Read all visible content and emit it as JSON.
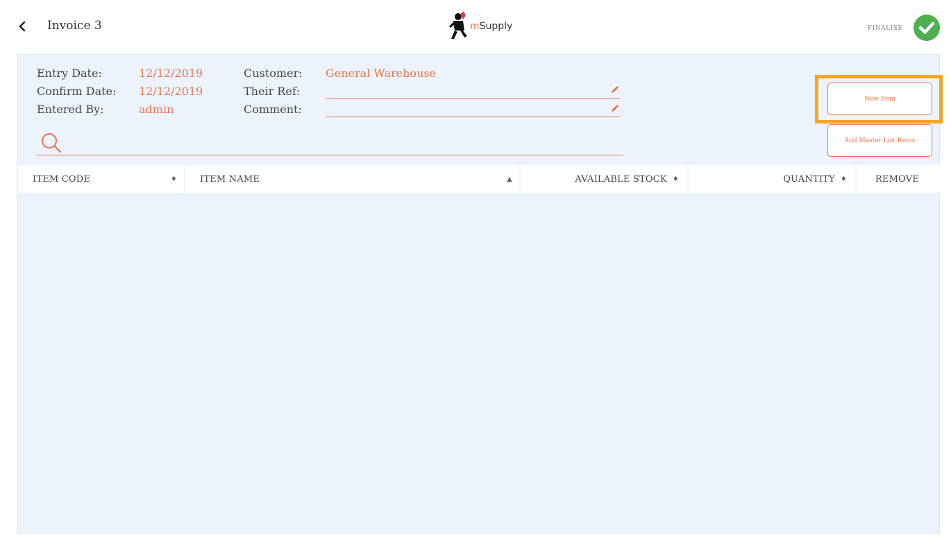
{
  "header": {
    "title": "Invoice 3",
    "logo_prefix": "m",
    "logo_text": "Supply",
    "finalise_label": "FINALISE"
  },
  "info": {
    "entry_date_label": "Entry Date:",
    "entry_date_value": "12/12/2019",
    "confirm_date_label": "Confirm Date:",
    "confirm_date_value": "12/12/2019",
    "entered_by_label": "Entered By:",
    "entered_by_value": "admin",
    "customer_label": "Customer:",
    "customer_value": "General Warehouse",
    "their_ref_label": "Their Ref:",
    "their_ref_value": "",
    "comment_label": "Comment:",
    "comment_value": ""
  },
  "search": {
    "value": "",
    "placeholder": ""
  },
  "buttons": {
    "new_item": "New Item",
    "add_master_list": "Add Master List Items"
  },
  "table": {
    "columns": {
      "item_code": "ITEM CODE",
      "item_name": "ITEM NAME",
      "available_stock": "AVAILABLE STOCK",
      "quantity": "QUANTITY",
      "remove": "REMOVE"
    },
    "rows": []
  },
  "colors": {
    "accent": "#e8734a",
    "finalise_green": "#4caf50",
    "panel_bg": "#edf3fc",
    "highlight": "#f5a623"
  },
  "icons": {
    "back": "chevron-left-icon",
    "finalise": "check-circle-icon",
    "search": "search-icon",
    "edit": "pencil-icon",
    "sort": "sort-icon"
  }
}
